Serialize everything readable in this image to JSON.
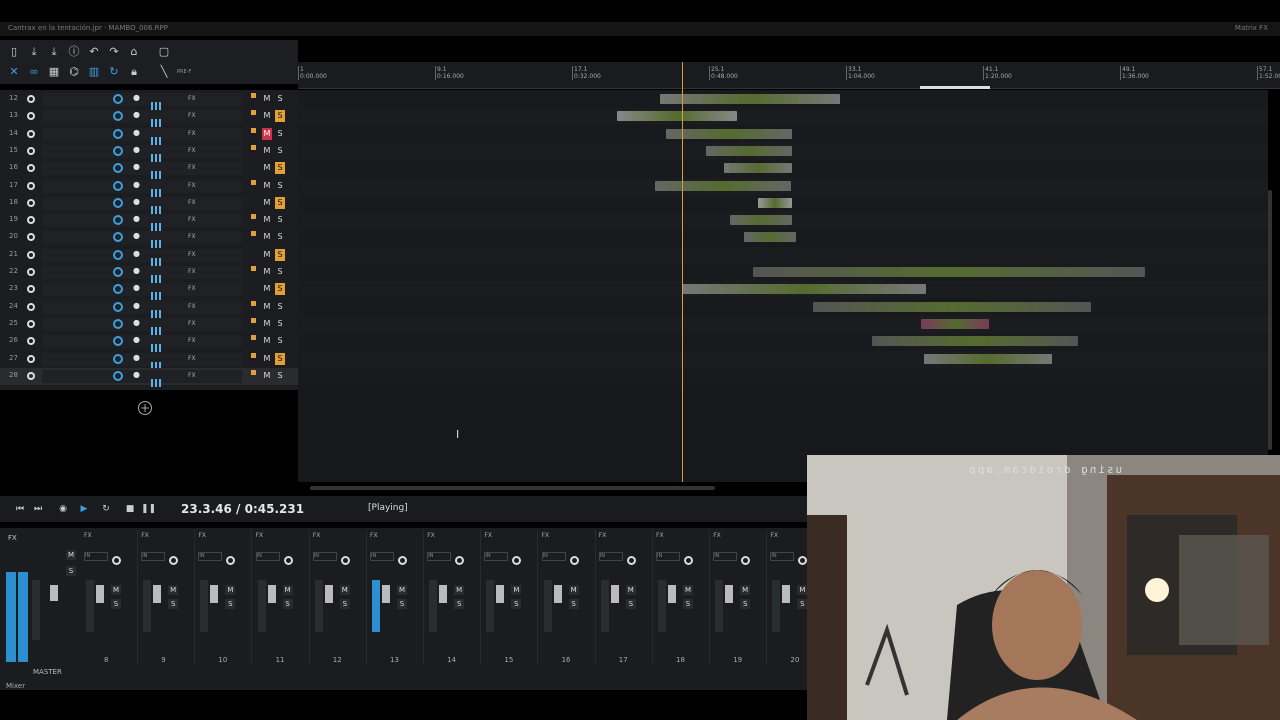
{
  "window": {
    "title": "Cantrax en la tentación.jpr · MAMBO_006.RPP",
    "right_label": "Matrix FX"
  },
  "timeline": {
    "ticks": [
      {
        "bar": "1",
        "time": "0:00.000"
      },
      {
        "bar": "9.1",
        "time": "0:16.000"
      },
      {
        "bar": "17.1",
        "time": "0:32.000"
      },
      {
        "bar": "25.1",
        "time": "0:48.000"
      },
      {
        "bar": "33.1",
        "time": "1:04.000"
      },
      {
        "bar": "41.1",
        "time": "1:20.000"
      },
      {
        "bar": "49.1",
        "time": "1:36.000"
      },
      {
        "bar": "57.1",
        "time": "1:52.000"
      }
    ]
  },
  "toolbar": {
    "pre_label": "PRE-F"
  },
  "tracks": [
    {
      "num": "12",
      "fx": "FX",
      "mute": false,
      "solo": false,
      "flag": true
    },
    {
      "num": "13",
      "fx": "FX",
      "mute": false,
      "solo": true,
      "flag": true
    },
    {
      "num": "14",
      "fx": "FX",
      "mute": true,
      "solo": false,
      "flag": true
    },
    {
      "num": "15",
      "fx": "FX",
      "mute": false,
      "solo": false,
      "flag": true
    },
    {
      "num": "16",
      "fx": "FX",
      "mute": false,
      "solo": true,
      "flag": false
    },
    {
      "num": "17",
      "fx": "FX",
      "mute": false,
      "solo": false,
      "flag": true
    },
    {
      "num": "18",
      "fx": "FX",
      "mute": false,
      "solo": true,
      "flag": false
    },
    {
      "num": "19",
      "fx": "FX",
      "mute": false,
      "solo": false,
      "flag": true
    },
    {
      "num": "20",
      "fx": "FX",
      "mute": false,
      "solo": false,
      "flag": true
    },
    {
      "num": "21",
      "fx": "FX",
      "mute": false,
      "solo": true,
      "flag": false
    },
    {
      "num": "22",
      "fx": "FX",
      "mute": false,
      "solo": false,
      "flag": true
    },
    {
      "num": "23",
      "fx": "FX",
      "mute": false,
      "solo": true,
      "flag": false
    },
    {
      "num": "24",
      "fx": "FX",
      "mute": false,
      "solo": false,
      "flag": true
    },
    {
      "num": "25",
      "fx": "FX",
      "mute": false,
      "solo": false,
      "flag": true
    },
    {
      "num": "26",
      "fx": "FX",
      "mute": false,
      "solo": false,
      "flag": true
    },
    {
      "num": "27",
      "fx": "FX",
      "mute": false,
      "solo": true,
      "flag": true
    },
    {
      "num": "28",
      "fx": "FX",
      "mute": false,
      "solo": false,
      "flag": true
    }
  ],
  "transport": {
    "position": "23.3.46 / 0:45.231",
    "status": "[Playing]"
  },
  "mixer": {
    "master_label": "MASTER",
    "tab_label": "Mixer",
    "strips": [
      "8",
      "9",
      "10",
      "11",
      "12",
      "13",
      "14",
      "15",
      "16",
      "17",
      "18",
      "19",
      "20"
    ],
    "fx_label": "FX",
    "in_label": "IN"
  },
  "webcam": {
    "overlay_text": "using droidcam.app"
  },
  "colors": {
    "accent": "#3aa0e0",
    "mute": "#d0304a",
    "solo": "#e0a035",
    "playhead": "#d4a030"
  }
}
